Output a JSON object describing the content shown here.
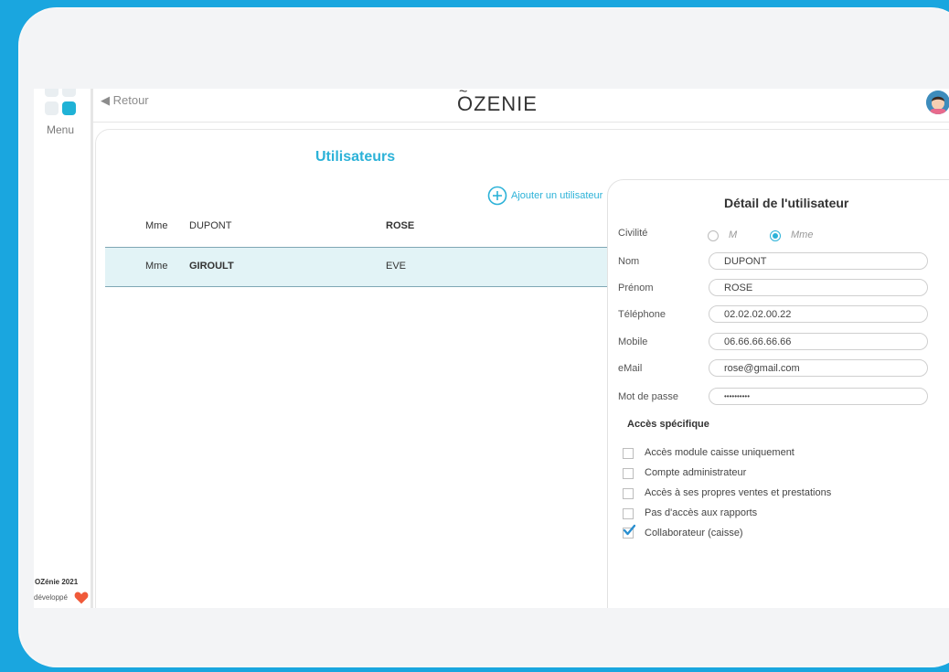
{
  "header": {
    "back_label": "◀ Retour",
    "logo_text": "ZENIE",
    "logo_initial": "O",
    "logo_tilde": "~"
  },
  "sidebar": {
    "menu_label": "Menu",
    "footer_brand": "OZénie 2021",
    "footer_dev": "développé"
  },
  "users": {
    "title": "Utilisateurs",
    "add_label": "Ajouter un utilisateur",
    "rows": [
      {
        "civ": "Mme",
        "name": "DUPONT",
        "first": "ROSE",
        "selected": false
      },
      {
        "civ": "Mme",
        "name": "GIROULT",
        "first": "EVE",
        "selected": true
      }
    ]
  },
  "detail": {
    "title": "Détail de l'utilisateur",
    "civilite_label": "Civilité",
    "civ_m": "M",
    "civ_mme": "Mme",
    "civ_selected": "Mme",
    "fields": [
      {
        "label": "Nom",
        "value": "DUPONT"
      },
      {
        "label": "Prénom",
        "value": "ROSE"
      },
      {
        "label": "Téléphone",
        "value": "02.02.02.00.22"
      },
      {
        "label": "Mobile",
        "value": "06.66.66.66.66"
      },
      {
        "label": "eMail",
        "value": "rose@gmail.com"
      },
      {
        "label": "Mot de passe",
        "value": "••••••••••"
      }
    ],
    "access_title": "Accès spécifique",
    "access": [
      {
        "label": "Accès module caisse uniquement",
        "checked": false
      },
      {
        "label": "Compte administrateur",
        "checked": false
      },
      {
        "label": "Accès à ses propres ventes et prestations",
        "checked": false
      },
      {
        "label": "Pas d'accès aux rapports",
        "checked": false
      },
      {
        "label": "Collaborateur (caisse)",
        "checked": true
      }
    ]
  },
  "colors": {
    "accent": "#2cb2d8",
    "background": "#1aa6df",
    "selected_row": "#e2f3f6",
    "heart": "#f05a3a"
  }
}
